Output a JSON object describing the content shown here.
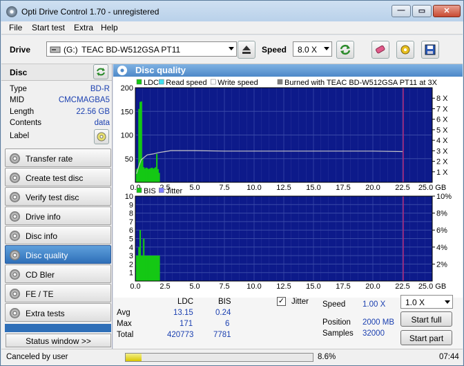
{
  "window": {
    "title": "Opti Drive Control 1.70 - unregistered"
  },
  "menu": {
    "file": "File",
    "start_test": "Start test",
    "extra": "Extra",
    "help": "Help"
  },
  "toolbar": {
    "drive_label": "Drive",
    "drive_letter": "(G:)",
    "drive_name": "TEAC BD-W512GSA PT11",
    "speed_label": "Speed",
    "speed_value": "8.0 X"
  },
  "disc": {
    "header": "Disc",
    "type_label": "Type",
    "type_value": "BD-R",
    "mid_label": "MID",
    "mid_value": "CMCMAGBA5",
    "length_label": "Length",
    "length_value": "22.56 GB",
    "contents_label": "Contents",
    "contents_value": "data",
    "label_label": "Label"
  },
  "nav": [
    {
      "label": "Transfer rate"
    },
    {
      "label": "Create test disc"
    },
    {
      "label": "Verify test disc"
    },
    {
      "label": "Drive info"
    },
    {
      "label": "Disc info"
    },
    {
      "label": "Disc quality"
    },
    {
      "label": "CD Bler"
    },
    {
      "label": "FE / TE"
    },
    {
      "label": "Extra tests"
    }
  ],
  "status_window_button": "Status window >>",
  "panel": {
    "title": "Disc quality"
  },
  "chart_data": [
    {
      "type": "bar",
      "legend": [
        "LDC",
        "Read speed",
        "Write speed",
        "Burned with TEAC BD-W512GSA PT11 at 3X"
      ],
      "x_ticks": [
        "0.0",
        "2.5",
        "5.0",
        "7.5",
        "10.0",
        "12.5",
        "15.0",
        "17.5",
        "20.0",
        "22.5",
        "25.0 GB"
      ],
      "y_ticks": [
        "200",
        "150",
        "100",
        "50"
      ],
      "y2_ticks": [
        "8 X",
        "7 X",
        "6 X",
        "5 X",
        "4 X",
        "3 X",
        "2 X",
        "1 X"
      ],
      "xlim": [
        0,
        25
      ],
      "ylim": [
        0,
        200
      ],
      "series": [
        {
          "name": "LDC",
          "color": "#14c814",
          "x": [
            0.1,
            0.2,
            0.3,
            0.4,
            0.5,
            0.6,
            0.7,
            0.8,
            0.9,
            1.0,
            1.1,
            1.2,
            1.3,
            1.4,
            1.5,
            1.6,
            1.7,
            1.8,
            1.9,
            2.0
          ],
          "values": [
            28,
            30,
            155,
            170,
            171,
            50,
            32,
            29,
            31,
            30,
            28,
            29,
            30,
            31,
            29,
            30,
            32,
            60,
            28,
            20
          ]
        },
        {
          "name": "Read speed",
          "color": "#c8c8c8",
          "x": [
            0.1,
            0.3,
            0.5,
            1,
            1.5,
            2,
            2.5,
            3,
            5,
            7.5,
            10,
            12.5,
            15,
            17.5,
            20,
            22.5
          ],
          "values": [
            18,
            35,
            48,
            58,
            60,
            63,
            65,
            67,
            67,
            66,
            66,
            66,
            66,
            66,
            66,
            65
          ]
        }
      ],
      "marker_x": 22.56
    },
    {
      "type": "bar",
      "legend": [
        "BIS",
        "Jitter"
      ],
      "x_ticks": [
        "0.0",
        "2.5",
        "5.0",
        "7.5",
        "10.0",
        "12.5",
        "15.0",
        "17.5",
        "20.0",
        "22.5",
        "25.0 GB"
      ],
      "y_ticks": [
        "10",
        "9",
        "8",
        "7",
        "6",
        "5",
        "4",
        "3",
        "2",
        "1"
      ],
      "y2_ticks": [
        "10%",
        "8%",
        "6%",
        "4%",
        "2%"
      ],
      "xlim": [
        0,
        25
      ],
      "ylim": [
        0,
        10
      ],
      "series": [
        {
          "name": "BIS",
          "color": "#14c814",
          "x": [
            0.1,
            0.2,
            0.3,
            0.4,
            0.5,
            0.6,
            0.7,
            0.8,
            0.9,
            1.0,
            1.1,
            1.2,
            1.3,
            1.4,
            1.5,
            1.6,
            1.7,
            1.8,
            1.9,
            2.0
          ],
          "values": [
            3,
            3,
            4,
            6,
            3,
            3,
            5,
            3,
            3,
            3,
            3,
            3,
            3,
            3,
            3,
            3,
            3,
            3,
            3,
            3
          ]
        }
      ],
      "marker_x": 22.56
    }
  ],
  "stats": {
    "col_ldc": "LDC",
    "col_bis": "BIS",
    "avg_label": "Avg",
    "avg_ldc": "13.15",
    "avg_bis": "0.24",
    "max_label": "Max",
    "max_ldc": "171",
    "max_bis": "6",
    "total_label": "Total",
    "total_ldc": "420773",
    "total_bis": "7781",
    "jitter_label": "Jitter",
    "speed_label": "Speed",
    "speed_value": "1.00 X",
    "position_label": "Position",
    "position_value": "2000 MB",
    "samples_label": "Samples",
    "samples_value": "32000",
    "speed_select": "1.0 X",
    "start_full": "Start full",
    "start_part": "Start part"
  },
  "statusbar": {
    "text": "Canceled by user",
    "progress": 0.086,
    "percent": "8.6%",
    "time": "07:44"
  }
}
